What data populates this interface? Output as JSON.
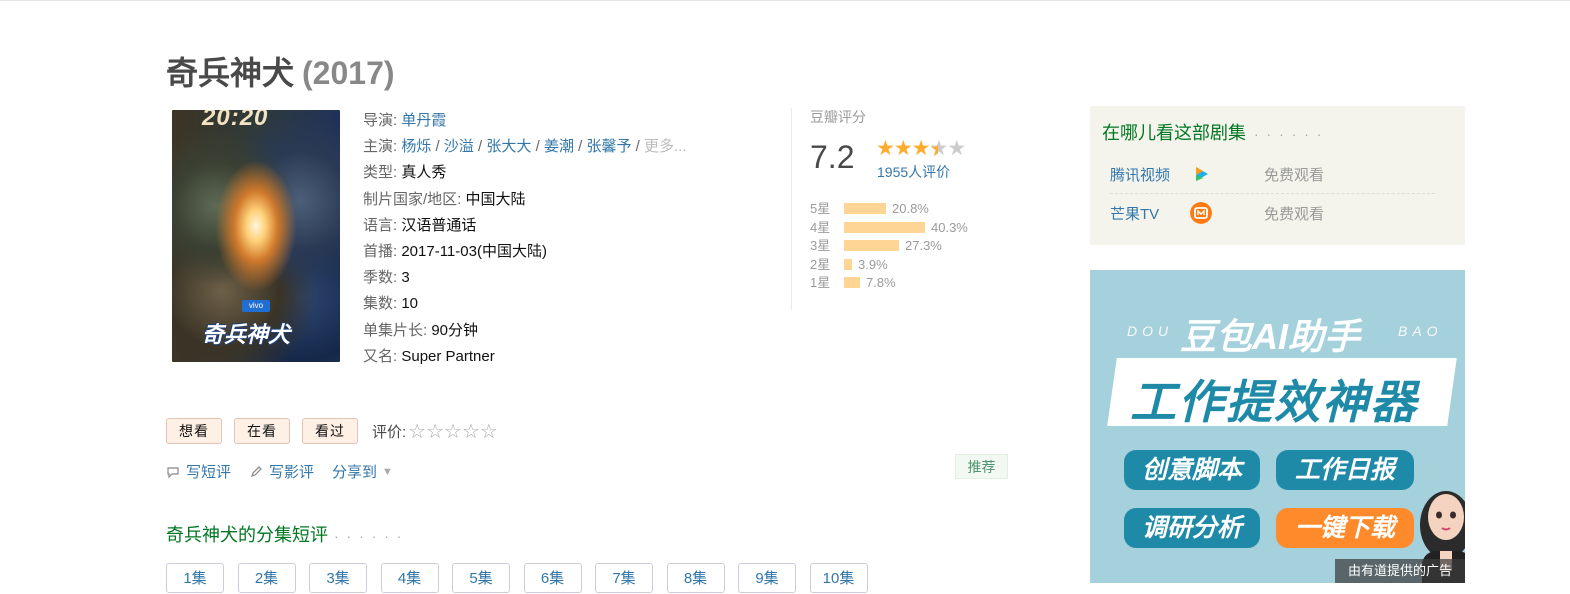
{
  "title": {
    "name": "奇兵神犬",
    "year": "(2017)"
  },
  "poster": {
    "top_text": "20:20",
    "brand": "vivo",
    "title_text": "奇兵神犬"
  },
  "info": {
    "director_label": "导演:",
    "director": "单丹霞",
    "cast_label": "主演:",
    "cast": [
      "杨烁",
      "沙溢",
      "张大大",
      "姜潮",
      "张馨予"
    ],
    "cast_more": "更多...",
    "genre_label": "类型:",
    "genre": "真人秀",
    "region_label": "制片国家/地区:",
    "region": "中国大陆",
    "language_label": "语言:",
    "language": "汉语普通话",
    "premiere_label": "首播:",
    "premiere": "2017-11-03(中国大陆)",
    "seasons_label": "季数:",
    "seasons": "3",
    "episodes_label": "集数:",
    "episodes": "10",
    "runtime_label": "单集片长:",
    "runtime": "90分钟",
    "aka_label": "又名:",
    "aka": "Super Partner"
  },
  "rating": {
    "title": "豆瓣评分",
    "score": "7.2",
    "stars": 3.5,
    "count": "1955人评价",
    "breakdown": [
      {
        "label": "5星",
        "pct": "20.8%",
        "value": 20.8
      },
      {
        "label": "4星",
        "pct": "40.3%",
        "value": 40.3
      },
      {
        "label": "3星",
        "pct": "27.3%",
        "value": 27.3
      },
      {
        "label": "2星",
        "pct": "3.9%",
        "value": 3.9
      },
      {
        "label": "1星",
        "pct": "7.8%",
        "value": 7.8
      }
    ]
  },
  "actions": {
    "want": "想看",
    "watching": "在看",
    "watched": "看过",
    "rate_label": "评价:",
    "rate_stars": "☆☆☆☆☆",
    "short_review": "写短评",
    "review": "写影评",
    "share": "分享到",
    "recommend": "推荐"
  },
  "episode_section": {
    "title": "奇兵神犬的分集短评",
    "dots": "· · · · · ·",
    "episodes": [
      "1集",
      "2集",
      "3集",
      "4集",
      "5集",
      "6集",
      "7集",
      "8集",
      "9集",
      "10集"
    ]
  },
  "where": {
    "title": "在哪儿看这部剧集",
    "dots": "· · · · · ·",
    "providers": [
      {
        "name": "腾讯视频",
        "price": "免费观看",
        "icon": "tencent-video-icon"
      },
      {
        "name": "芒果TV",
        "price": "免费观看",
        "icon": "mango-tv-icon"
      }
    ]
  },
  "ad": {
    "dou": "DOU",
    "bao": "BAO",
    "headline": "豆包AI助手",
    "banner": "工作提效神器",
    "pills": [
      "创意脚本",
      "工作日报",
      "调研分析",
      "一键下载"
    ],
    "note": "由有道提供的广告"
  },
  "colors": {
    "link": "#3377aa",
    "green_title": "#007722",
    "star": "#ffac2d",
    "bar": "#ffd596",
    "ad_bg": "#a5d1dd"
  }
}
